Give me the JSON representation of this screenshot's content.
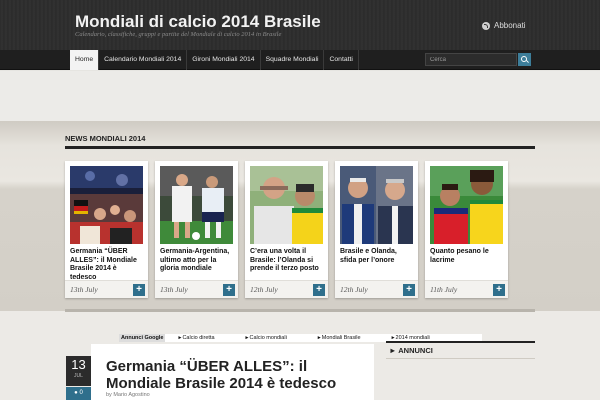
{
  "header": {
    "title": "Mondiali di calcio 2014 Brasile",
    "tagline": "Calendario, classifiche, gruppi e partite del Mondiale di calcio 2014 in Brasile",
    "subscribe_label": "Abbonati"
  },
  "nav": {
    "items": [
      "Home",
      "Calendario Mondiali 2014",
      "Gironi Mondiali 2014",
      "Squadre Mondiali",
      "Contatti"
    ],
    "active_index": 0
  },
  "search": {
    "placeholder": "Cerca"
  },
  "news": {
    "heading": "NEWS MONDIALI 2014",
    "items": [
      {
        "title": "Germania “ÜBER ALLES”: il Mondiale Brasile 2014 è tedesco",
        "date": "13th July"
      },
      {
        "title": "Germania-Argentina, ultimo atto per la gloria mondiale",
        "date": "13th July"
      },
      {
        "title": "C’era una volta il Brasile: l’Olanda si prende il terzo posto",
        "date": "12th July"
      },
      {
        "title": "Brasile e Olanda, sfida per l’onore",
        "date": "12th July"
      },
      {
        "title": "Quanto pesano le lacrime",
        "date": "11th July"
      }
    ]
  },
  "ads": {
    "label": "Annunci Google",
    "links": [
      "Calcio diretta",
      "Calcio mondiali",
      "Mondiali Brasile",
      "2014 mondiali"
    ]
  },
  "post": {
    "day": "13",
    "month": "JUL",
    "comments": "0",
    "title": "Germania “ÜBER ALLES”: il Mondiale Brasile 2014 è tedesco",
    "author": "by Mario Agostino"
  },
  "sidebar": {
    "heading": "ANNUNCI"
  },
  "colors": {
    "accent": "#2f6f8c",
    "header_bg": "#2b2b2b",
    "nav_bg": "#1f1f1f"
  }
}
